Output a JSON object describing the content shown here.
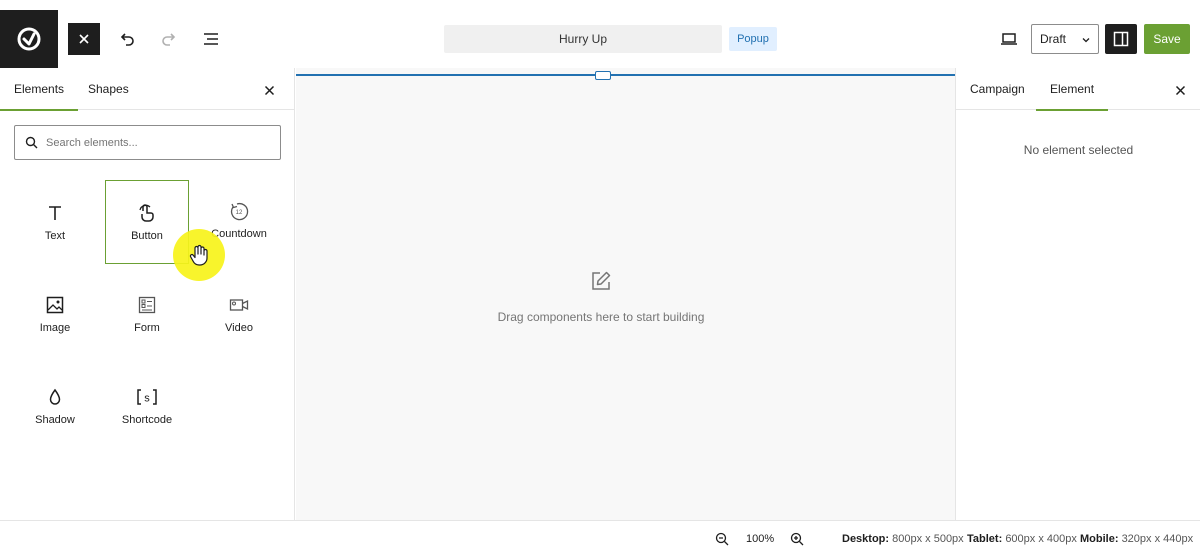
{
  "topbar": {
    "title": "Hurry Up",
    "type_badge": "Popup",
    "status": "Draft",
    "save_label": "Save"
  },
  "left_panel": {
    "tabs": [
      {
        "label": "Elements",
        "active": true
      },
      {
        "label": "Shapes",
        "active": false
      }
    ],
    "search_placeholder": "Search elements...",
    "elements": [
      {
        "label": "Text",
        "icon": "text-icon"
      },
      {
        "label": "Button",
        "icon": "button-tap-icon",
        "selected": true
      },
      {
        "label": "Countdown",
        "icon": "countdown-icon"
      },
      {
        "label": "Image",
        "icon": "image-icon"
      },
      {
        "label": "Form",
        "icon": "form-icon"
      },
      {
        "label": "Video",
        "icon": "video-icon"
      },
      {
        "label": "Shadow",
        "icon": "shadow-drop-icon"
      },
      {
        "label": "Shortcode",
        "icon": "shortcode-icon"
      }
    ]
  },
  "canvas": {
    "hint": "Drag components here to start building"
  },
  "right_panel": {
    "tabs": [
      {
        "label": "Campaign",
        "active": false
      },
      {
        "label": "Element",
        "active": true
      }
    ],
    "empty_text": "No element selected"
  },
  "footer": {
    "zoom": "100%",
    "desktop_label": "Desktop:",
    "desktop_value": "800px x 500px",
    "tablet_label": "Tablet:",
    "tablet_value": "600px x 400px",
    "mobile_label": "Mobile:",
    "mobile_value": "320px x 440px"
  },
  "colors": {
    "accent": "#6ba033",
    "frame": "#2271b1",
    "dark": "#1e1e1e",
    "cursor_highlight": "#f7f31a"
  }
}
